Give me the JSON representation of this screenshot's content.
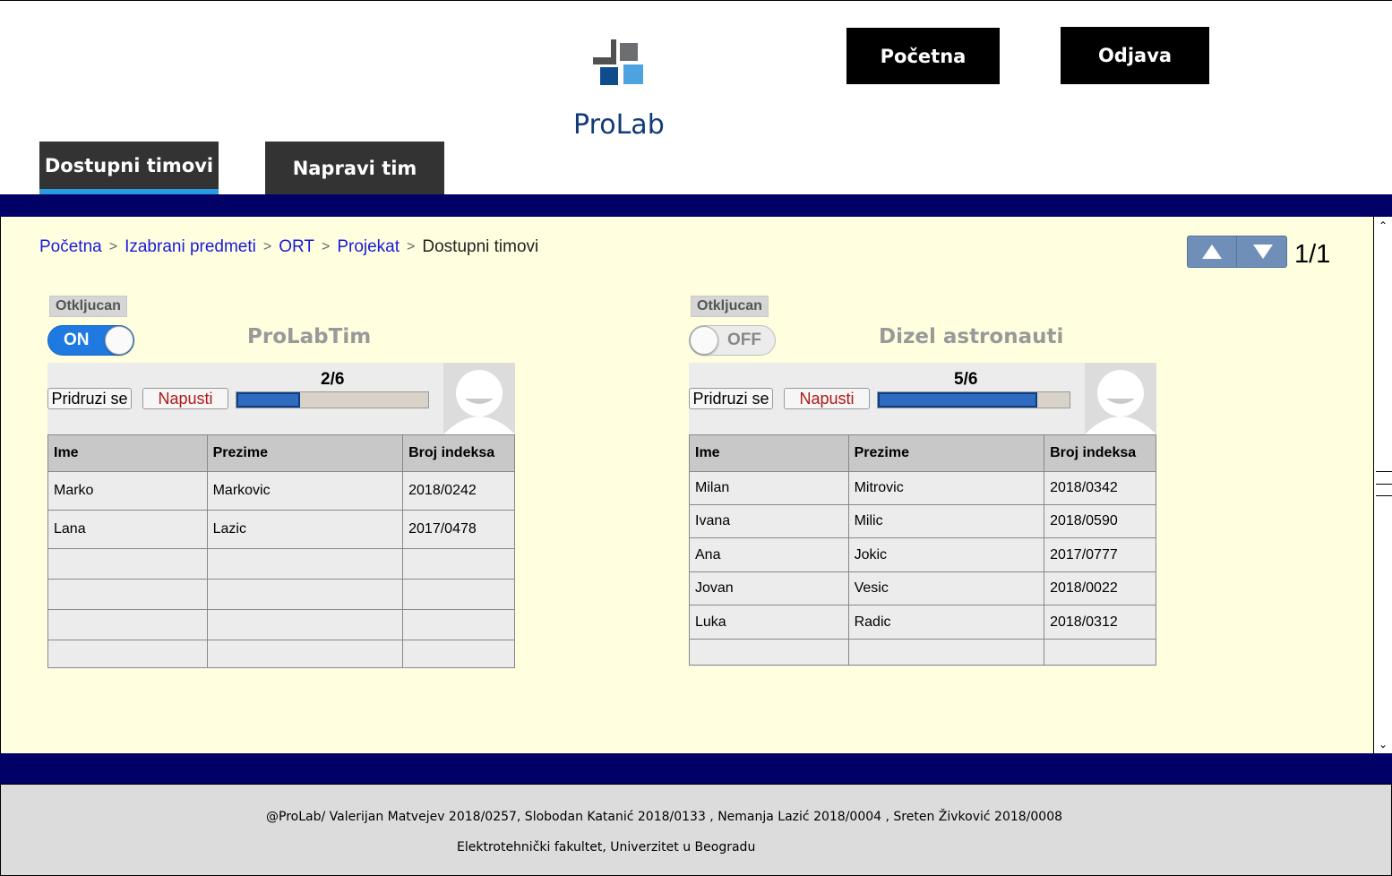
{
  "header": {
    "logo_text": "ProLab",
    "home_label": "Početna",
    "logout_label": "Odjava"
  },
  "tabs": [
    {
      "label": "Dostupni timovi",
      "active": true
    },
    {
      "label": "Napravi tim",
      "active": false
    }
  ],
  "breadcrumb": {
    "items": [
      "Početna",
      "Izabrani predmeti",
      "ORT",
      "Projekat"
    ],
    "separator": ">",
    "current": "Dostupni timovi"
  },
  "pager": {
    "up_icon": "triangle-up-icon",
    "down_icon": "triangle-down-icon",
    "page": "1/1"
  },
  "teams": [
    {
      "lock_label": "Otkljucan",
      "toggle_label": "ON",
      "toggle_on": true,
      "name": "ProLabTim",
      "join_label": "Pridruzi se",
      "leave_label": "Napusti",
      "members_label": "2/6",
      "progress_fraction": 0.333,
      "columns": [
        "Ime",
        "Prezime",
        "Broj indeksa"
      ],
      "rows": [
        [
          "Marko",
          "Markovic",
          "2018/0242"
        ],
        [
          "Lana",
          "Lazic",
          "2017/0478"
        ],
        [
          "",
          "",
          ""
        ],
        [
          "",
          "",
          ""
        ],
        [
          "",
          "",
          ""
        ],
        [
          "",
          "",
          ""
        ]
      ]
    },
    {
      "lock_label": "Otkljucan",
      "toggle_label": "OFF",
      "toggle_on": false,
      "name": "Dizel astronauti",
      "join_label": "Pridruzi se",
      "leave_label": "Napusti",
      "members_label": "5/6",
      "progress_fraction": 0.833,
      "columns": [
        "Ime",
        "Prezime",
        "Broj indeksa"
      ],
      "rows": [
        [
          "Milan",
          "Mitrovic",
          "2018/0342"
        ],
        [
          "Ivana",
          "Milic",
          "2018/0590"
        ],
        [
          "Ana",
          "Jokic",
          "2017/0777"
        ],
        [
          "Jovan",
          "Vesic",
          "2018/0022"
        ],
        [
          "Luka",
          "Radic",
          "2018/0312"
        ],
        [
          "",
          "",
          ""
        ]
      ]
    }
  ],
  "footer": {
    "line1": "@ProLab/ Valerijan Matvejev 2018/0257, Slobodan Katanić 2018/0133 , Nemanja Lazić 2018/0004 , Sreten Živković 2018/0008",
    "line2": "Elektrotehnički fakultet, Univerzitet u Beogradu"
  },
  "colors": {
    "navy": "#000066",
    "content_bg": "#ffffe0",
    "tab_active_underline": "#2a9be0",
    "link": "#1a1adb",
    "toggle_on": "#1e7ae0",
    "progress_fill": "#2f6cc0",
    "leave_text": "#b01818"
  }
}
